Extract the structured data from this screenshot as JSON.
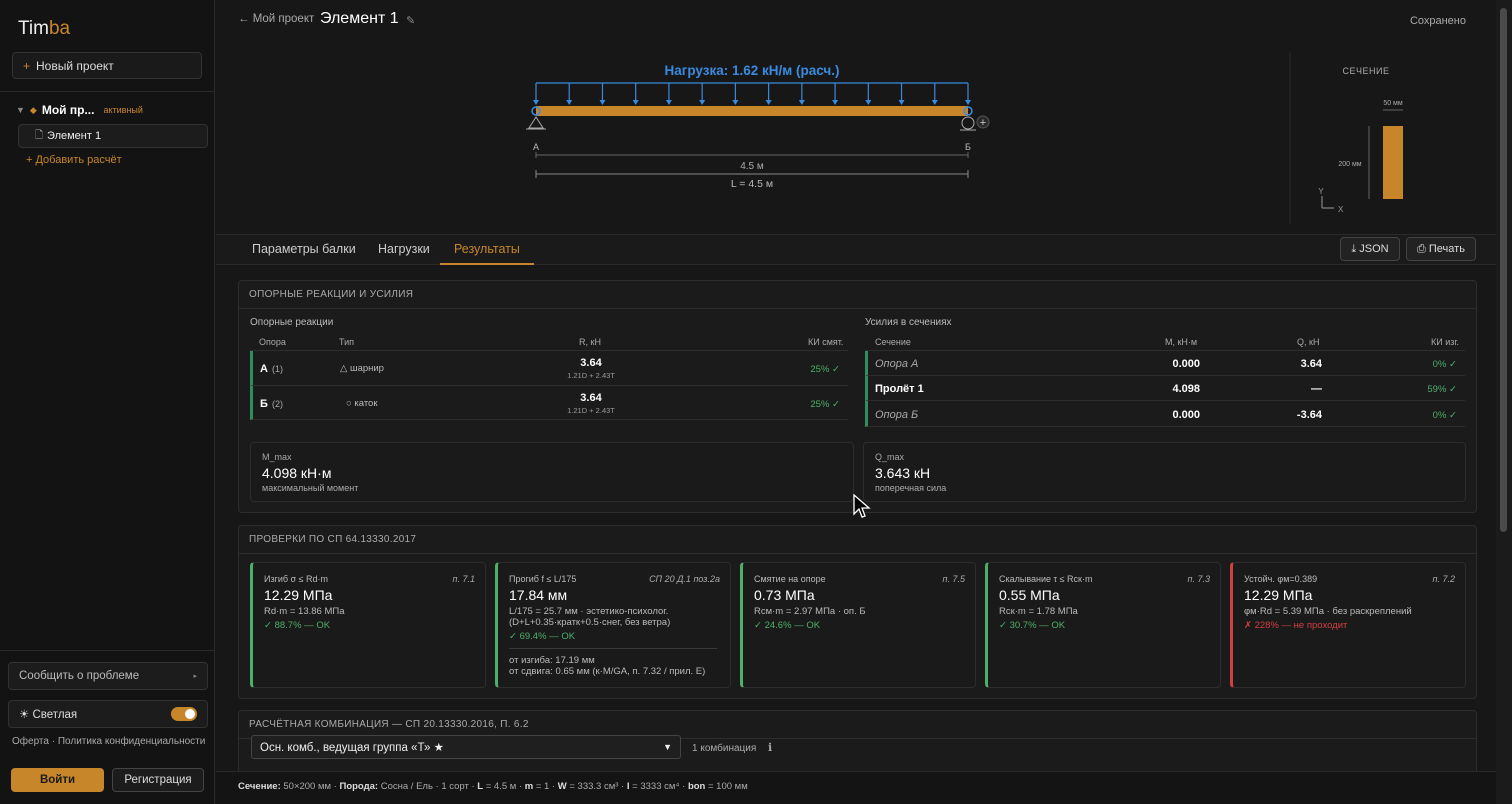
{
  "sidebar": {
    "logo_a": "Tim",
    "logo_b": "ba",
    "new_project": "Новый проект",
    "project_name": "Мой пр...",
    "project_badge": "активный",
    "element_name": "Элемент 1",
    "add_calc": "+ Добавить расчёт",
    "report_issue": "Сообщить о проблеме",
    "theme_label": "☀ Светлая",
    "legal": "Оферта · Политика конфиденциальности",
    "login": "Войти",
    "register": "Регистрация"
  },
  "header": {
    "back": "← Мой проект",
    "title": "Элемент 1",
    "status": "Сохранено"
  },
  "beam": {
    "load_label": "Нагрузка: 1.62 кН/м (расч.)",
    "support_a": "A",
    "support_b": "Б",
    "span": "4.5 м",
    "total_length": "L = 4.5 м",
    "section_title": "СЕЧЕНИЕ",
    "section_width": "50 мм",
    "section_height": "200 мм",
    "axis_y": "Y",
    "axis_x": "X"
  },
  "tabs": [
    "Параметры балки",
    "Нагрузки",
    "Результаты"
  ],
  "toolbar": {
    "json": "⤓ JSON",
    "print": "⎙ Печать"
  },
  "reactions": {
    "panel_title": "ОПОРНЫЕ РЕАКЦИИ И УСИЛИЯ",
    "reactions_title": "Опорные реакции",
    "headers": [
      "Опора",
      "Тип",
      "R, кН",
      "КИ смят."
    ],
    "rows": [
      {
        "support": "А",
        "num": "(1)",
        "type": "△ шарнир",
        "r": "3.64",
        "combo": "1.21D + 2.43T",
        "ki": "25% ✓"
      },
      {
        "support": "Б",
        "num": "(2)",
        "type": "○ каток",
        "r": "3.64",
        "combo": "1.21D + 2.43T",
        "ki": "25% ✓"
      }
    ],
    "forces_title": "Усилия в сечениях",
    "forces_headers": [
      "Сечение",
      "М, кН·м",
      "Q, кН",
      "КИ изг."
    ],
    "forces_rows": [
      {
        "section": "Опора А",
        "m": "0.000",
        "q": "3.64",
        "ki": "0% ✓"
      },
      {
        "section": "Пролёт 1",
        "m": "4.098",
        "q": "—",
        "ki": "59% ✓"
      },
      {
        "section": "Опора Б",
        "m": "0.000",
        "q": "-3.64",
        "ki": "0% ✓"
      }
    ],
    "mmax_label": "M_max",
    "mmax_value": "4.098 кН·м",
    "mmax_desc": "максимальный момент",
    "qmax_label": "Q_max",
    "qmax_value": "3.643 кН",
    "qmax_desc": "поперечная сила"
  },
  "checks": {
    "panel_title": "ПРОВЕРКИ ПО СП 64.13330.2017",
    "items": [
      {
        "title": "Изгиб σ ≤ Rd·m",
        "ref": "п. 7.1",
        "value": "12.29 МПа",
        "formula": "Rd·m = 13.86 МПа",
        "formula2": "",
        "status": "✓ 88.7% — OK",
        "extra1": "",
        "extra2": ""
      },
      {
        "title": "Прогиб f ≤ L/175",
        "ref": "СП 20 Д.1 поз.2а",
        "value": "17.84 мм",
        "formula": "L/175 = 25.7 мм · эстетико-психолог.",
        "formula2": "(D+L+0.35·кратк+0.5·снег, без ветра)",
        "status": "✓ 69.4% — OK",
        "extra1": "от изгиба: 17.19 мм",
        "extra2": "от сдвига: 0.65 мм (к·M/GA, п. 7.32 / прил. Е)"
      },
      {
        "title": "Смятие на опоре",
        "ref": "п. 7.5",
        "value": "0.73 МПа",
        "formula": "Rсм·m = 2.97 МПа · оп. Б",
        "formula2": "",
        "status": "✓ 24.6% — OK",
        "extra1": "",
        "extra2": ""
      },
      {
        "title": "Скалывание τ ≤ Rск·m",
        "ref": "п. 7.3",
        "value": "0.55 МПа",
        "formula": "Rск·m = 1.78 МПа",
        "formula2": "",
        "status": "✓ 30.7% — OK",
        "extra1": "",
        "extra2": ""
      },
      {
        "title": "Устойч. φм=0.389",
        "ref": "п. 7.2",
        "value": "12.29 МПа",
        "formula": "φм·Rd = 5.39 МПа · без раскреплений",
        "formula2": "",
        "status": "✗ 228% — не проходит",
        "extra1": "",
        "extra2": ""
      }
    ]
  },
  "combination": {
    "panel_title": "РАСЧЁТНАЯ КОМБИНАЦИЯ — СП 20.13330.2016, П. 6.2",
    "selected": "Осн. комб., ведущая группа «Т» ★",
    "count": "1 комбинация",
    "info": "ℹ"
  },
  "footer": {
    "section_label": "Сечение:",
    "section_value": "50×200 мм ·",
    "species_label": "Порода:",
    "species_value": "Сосна / Ель · 1 сорт ·",
    "l_label": "L",
    "l_value": "= 4.5 м ·",
    "m_label": "m",
    "m_value": "= 1 ·",
    "w_label": "W",
    "w_value": "= 333.3 см³ ·",
    "i_label": "I",
    "i_value": "= 3333 см⁴ ·",
    "bon_label": "bon",
    "bon_value": "= 100 мм"
  },
  "colors": {
    "accent": "#c8862a",
    "load_blue": "#3a8be0",
    "ok_green": "#4caf6a",
    "fail_red": "#d04040"
  }
}
